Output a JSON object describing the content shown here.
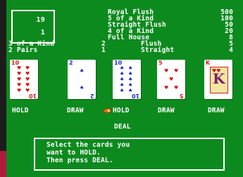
{
  "info": {
    "credits": "19",
    "bet": "1"
  },
  "paytable": [
    {
      "hand": "Royal Flush",
      "payout": "500"
    },
    {
      "hand": "5 of a Kind",
      "payout": "100"
    },
    {
      "hand": "Straight Flush",
      "payout": "50"
    },
    {
      "hand": "4 of a Kind",
      "payout": "20"
    },
    {
      "hand": "Full House",
      "payout": "8"
    }
  ],
  "paytable_low": [
    {
      "hand": "3 of a Kind",
      "payout": "2"
    },
    {
      "hand": "Flush",
      "payout": "5"
    },
    {
      "hand": "2 Pairs",
      "payout": "1"
    },
    {
      "hand": "Straight",
      "payout": "4"
    }
  ],
  "cards": [
    {
      "rank": "10",
      "suit": "hearts",
      "color": "red",
      "action": "HOLD"
    },
    {
      "rank": "2",
      "suit": "spades",
      "color": "blue",
      "action": "DRAW"
    },
    {
      "rank": "10",
      "suit": "spades",
      "color": "blue",
      "action": "HOLD"
    },
    {
      "rank": "5",
      "suit": "hearts",
      "color": "red",
      "action": "DRAW"
    },
    {
      "rank": "K",
      "suit": "hearts",
      "color": "red",
      "action": "DRAW"
    }
  ],
  "deal_label": "DEAL",
  "message": {
    "line1": "Select the cards you",
    "line2": "want to HOLD.",
    "line3": "Then press DEAL."
  },
  "icons": {
    "cursor": "pointing-hand-cursor-icon"
  },
  "colors": {
    "table": "#0d8a1e",
    "card_red": "#d51a1a",
    "card_blue": "#1a2ec9",
    "cursor": "#e8731a"
  }
}
